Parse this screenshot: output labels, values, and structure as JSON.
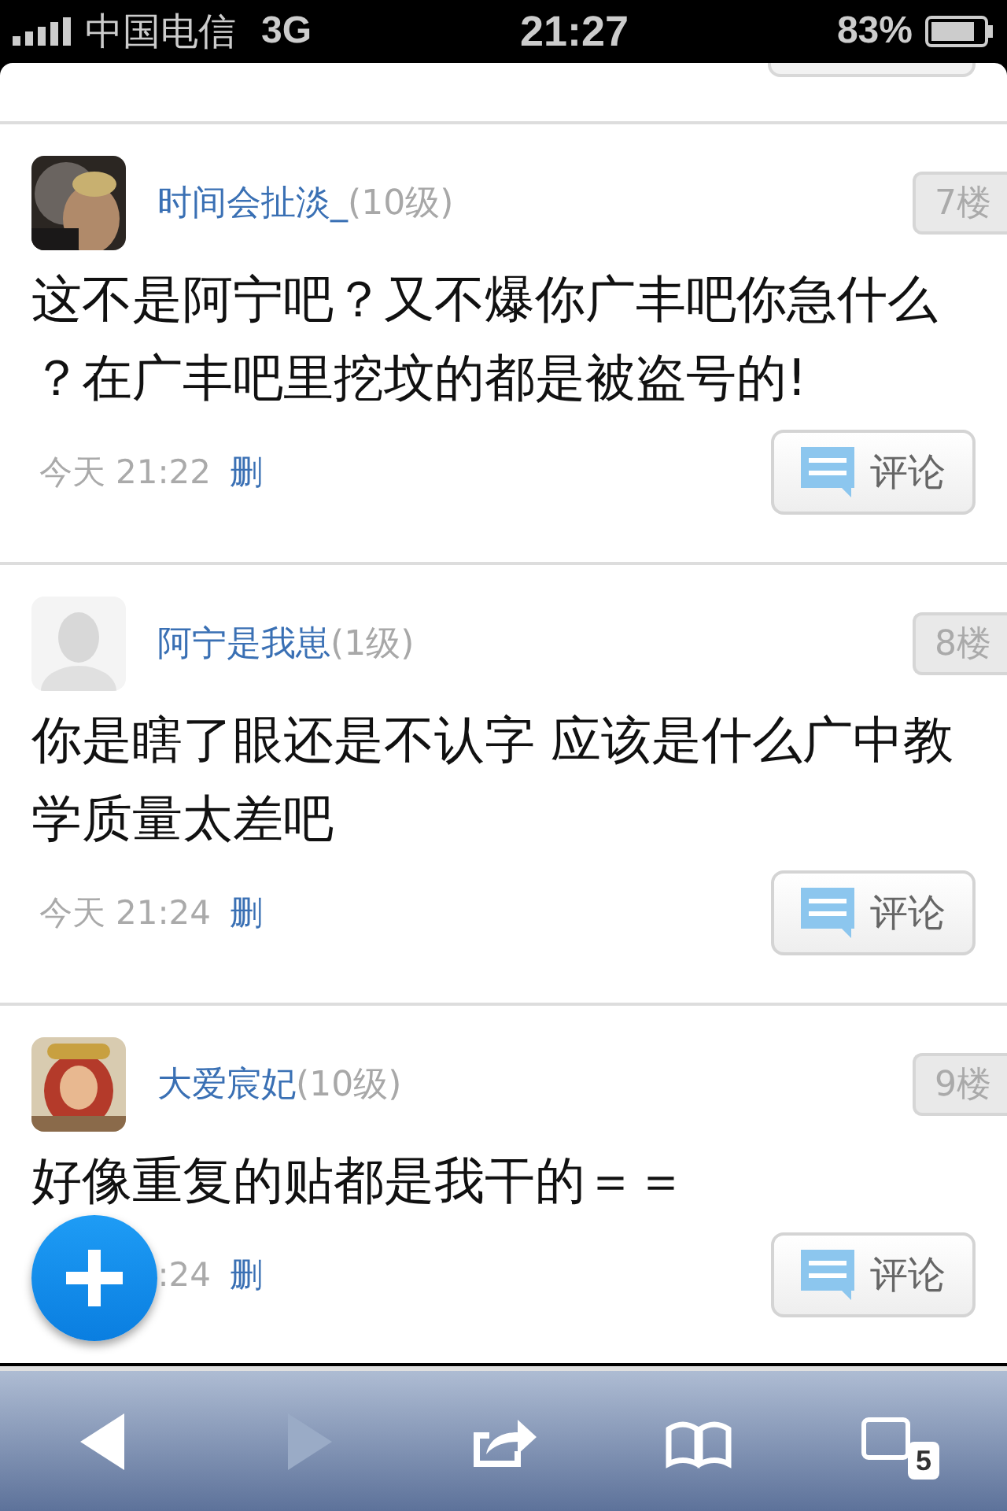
{
  "status_bar": {
    "carrier": "中国电信",
    "network": "3G",
    "time": "21:27",
    "battery": "83%"
  },
  "posts": [
    {
      "author": "时间会扯淡_",
      "level": "(10级)",
      "floor": "7楼",
      "body": "这不是阿宁吧？又不爆你广丰吧你急什么？在广丰吧里挖坟的都是被盗号的!",
      "time": "今天 21:22",
      "delete": "删",
      "comment": "评论"
    },
    {
      "author": "阿宁是我崽",
      "level": "(1级)",
      "floor": "8楼",
      "body": "你是瞎了眼还是不认字 应该是什么广中教学质量太差吧",
      "time": "今天 21:24",
      "delete": "删",
      "comment": "评论"
    },
    {
      "author": "大爱宸妃",
      "level": "(10级)",
      "floor": "9楼",
      "body": "好像重复的贴都是我干的＝＝",
      "time": ":24",
      "delete": "删",
      "comment": "评论"
    }
  ],
  "toolbar": [
    {
      "kind": "back",
      "disabled": false
    },
    {
      "kind": "forward",
      "disabled": true
    },
    {
      "kind": "share",
      "disabled": false
    },
    {
      "kind": "bookmarks",
      "disabled": false
    },
    {
      "kind": "tabs",
      "disabled": false,
      "badge": "5"
    }
  ]
}
